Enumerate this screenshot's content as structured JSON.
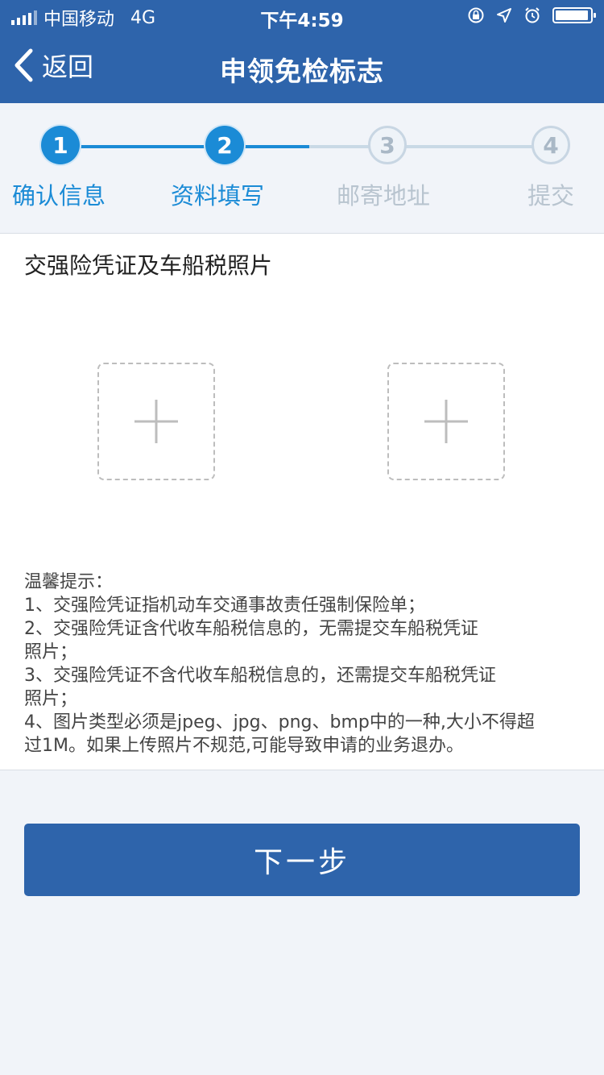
{
  "status_bar": {
    "carrier": "中国移动",
    "network": "4G",
    "time": "下午4:59",
    "icons": [
      "lock-rotation-icon",
      "location-icon",
      "alarm-icon",
      "battery-icon"
    ]
  },
  "nav": {
    "back_label": "返回",
    "title": "申领免检标志"
  },
  "steps": [
    {
      "number": "1",
      "label": "确认信息",
      "state": "done"
    },
    {
      "number": "2",
      "label": "资料填写",
      "state": "current"
    },
    {
      "number": "3",
      "label": "邮寄地址",
      "state": "pending"
    },
    {
      "number": "4",
      "label": "提交",
      "state": "pending"
    }
  ],
  "upload_section": {
    "title": "交强险凭证及车船税照片",
    "slots": [
      "add-photo",
      "add-photo"
    ]
  },
  "tips": {
    "heading": "温馨提示：",
    "lines": [
      "1、交强险凭证指机动车交通事故责任强制保险单；",
      "2、交强险凭证含代收车船税信息的，无需提交车船税凭证",
      "照片；",
      "3、交强险凭证不含代收车船税信息的，还需提交车船税凭证",
      "照片；",
      "4、图片类型必须是jpeg、jpg、png、bmp中的一种,大小不得超",
      "过1M。如果上传照片不规范,可能导致申请的业务退办。"
    ]
  },
  "next_button": "下一步",
  "colors": {
    "primary": "#2e64ab",
    "step_active": "#1b8bd6",
    "step_inactive": "#b8c4cf",
    "background": "#f1f4f9"
  }
}
